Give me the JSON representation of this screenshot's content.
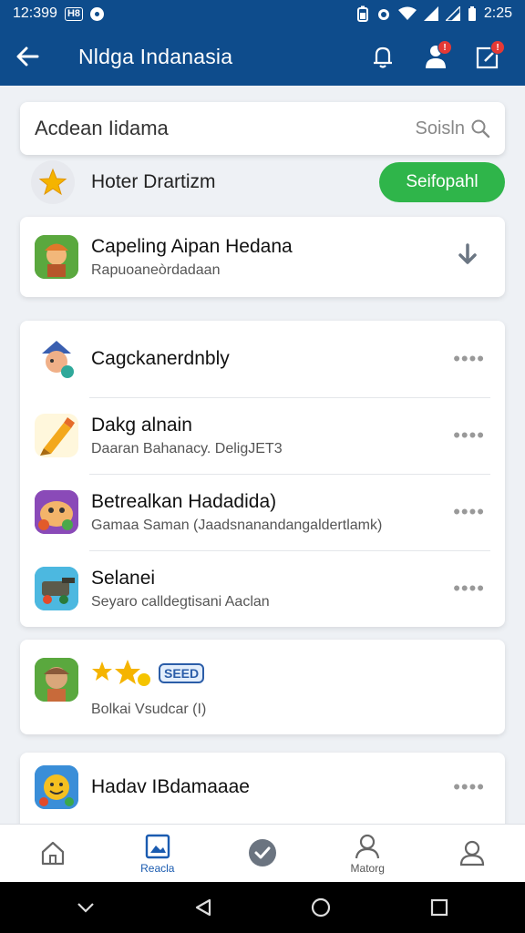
{
  "status_bar": {
    "time": "12:399",
    "box_label": "H8",
    "right_time": "2:25"
  },
  "app_bar": {
    "title": "Nldga Indanasia"
  },
  "search": {
    "title": "Acdean Iidama",
    "hint": "Soisln"
  },
  "feature": {
    "label": "Hoter Drartizm",
    "button": "Seifopahl"
  },
  "download_card": {
    "title": "Capeling Aipan Hedana",
    "subtitle": "Rapuoaneòrdadaan"
  },
  "list": [
    {
      "title": "Cagckanerdnbly",
      "subtitle": ""
    },
    {
      "title": "Dakg alnain",
      "subtitle": "Daaran Bahanacy. DeligJET3"
    },
    {
      "title": "Betrealkan Hadadida)",
      "subtitle": "Gamaa Saman (Jaadsnanandangaldertlamk)"
    },
    {
      "title": "Selanei",
      "subtitle": "Seyaro calldegtisani Aaclan"
    }
  ],
  "badge_card": {
    "badge": "SEED",
    "subtitle": "Bolkai Vsudcar (I)"
  },
  "last_card": {
    "title": "Hadav IBdamaaae"
  },
  "more_dots": "••••",
  "bottom_nav": [
    {
      "label": "",
      "icon": "home-icon"
    },
    {
      "label": "Reacla",
      "icon": "picture-icon"
    },
    {
      "label": "",
      "icon": "check-circle-icon"
    },
    {
      "label": "Matorg",
      "icon": "person-search-icon"
    },
    {
      "label": "",
      "icon": "profile-icon"
    }
  ],
  "colors": {
    "app_bar": "#0e4c8c",
    "accent_green": "#2fb54a",
    "notification": "#e53935",
    "nav_active": "#1a5bb0"
  }
}
